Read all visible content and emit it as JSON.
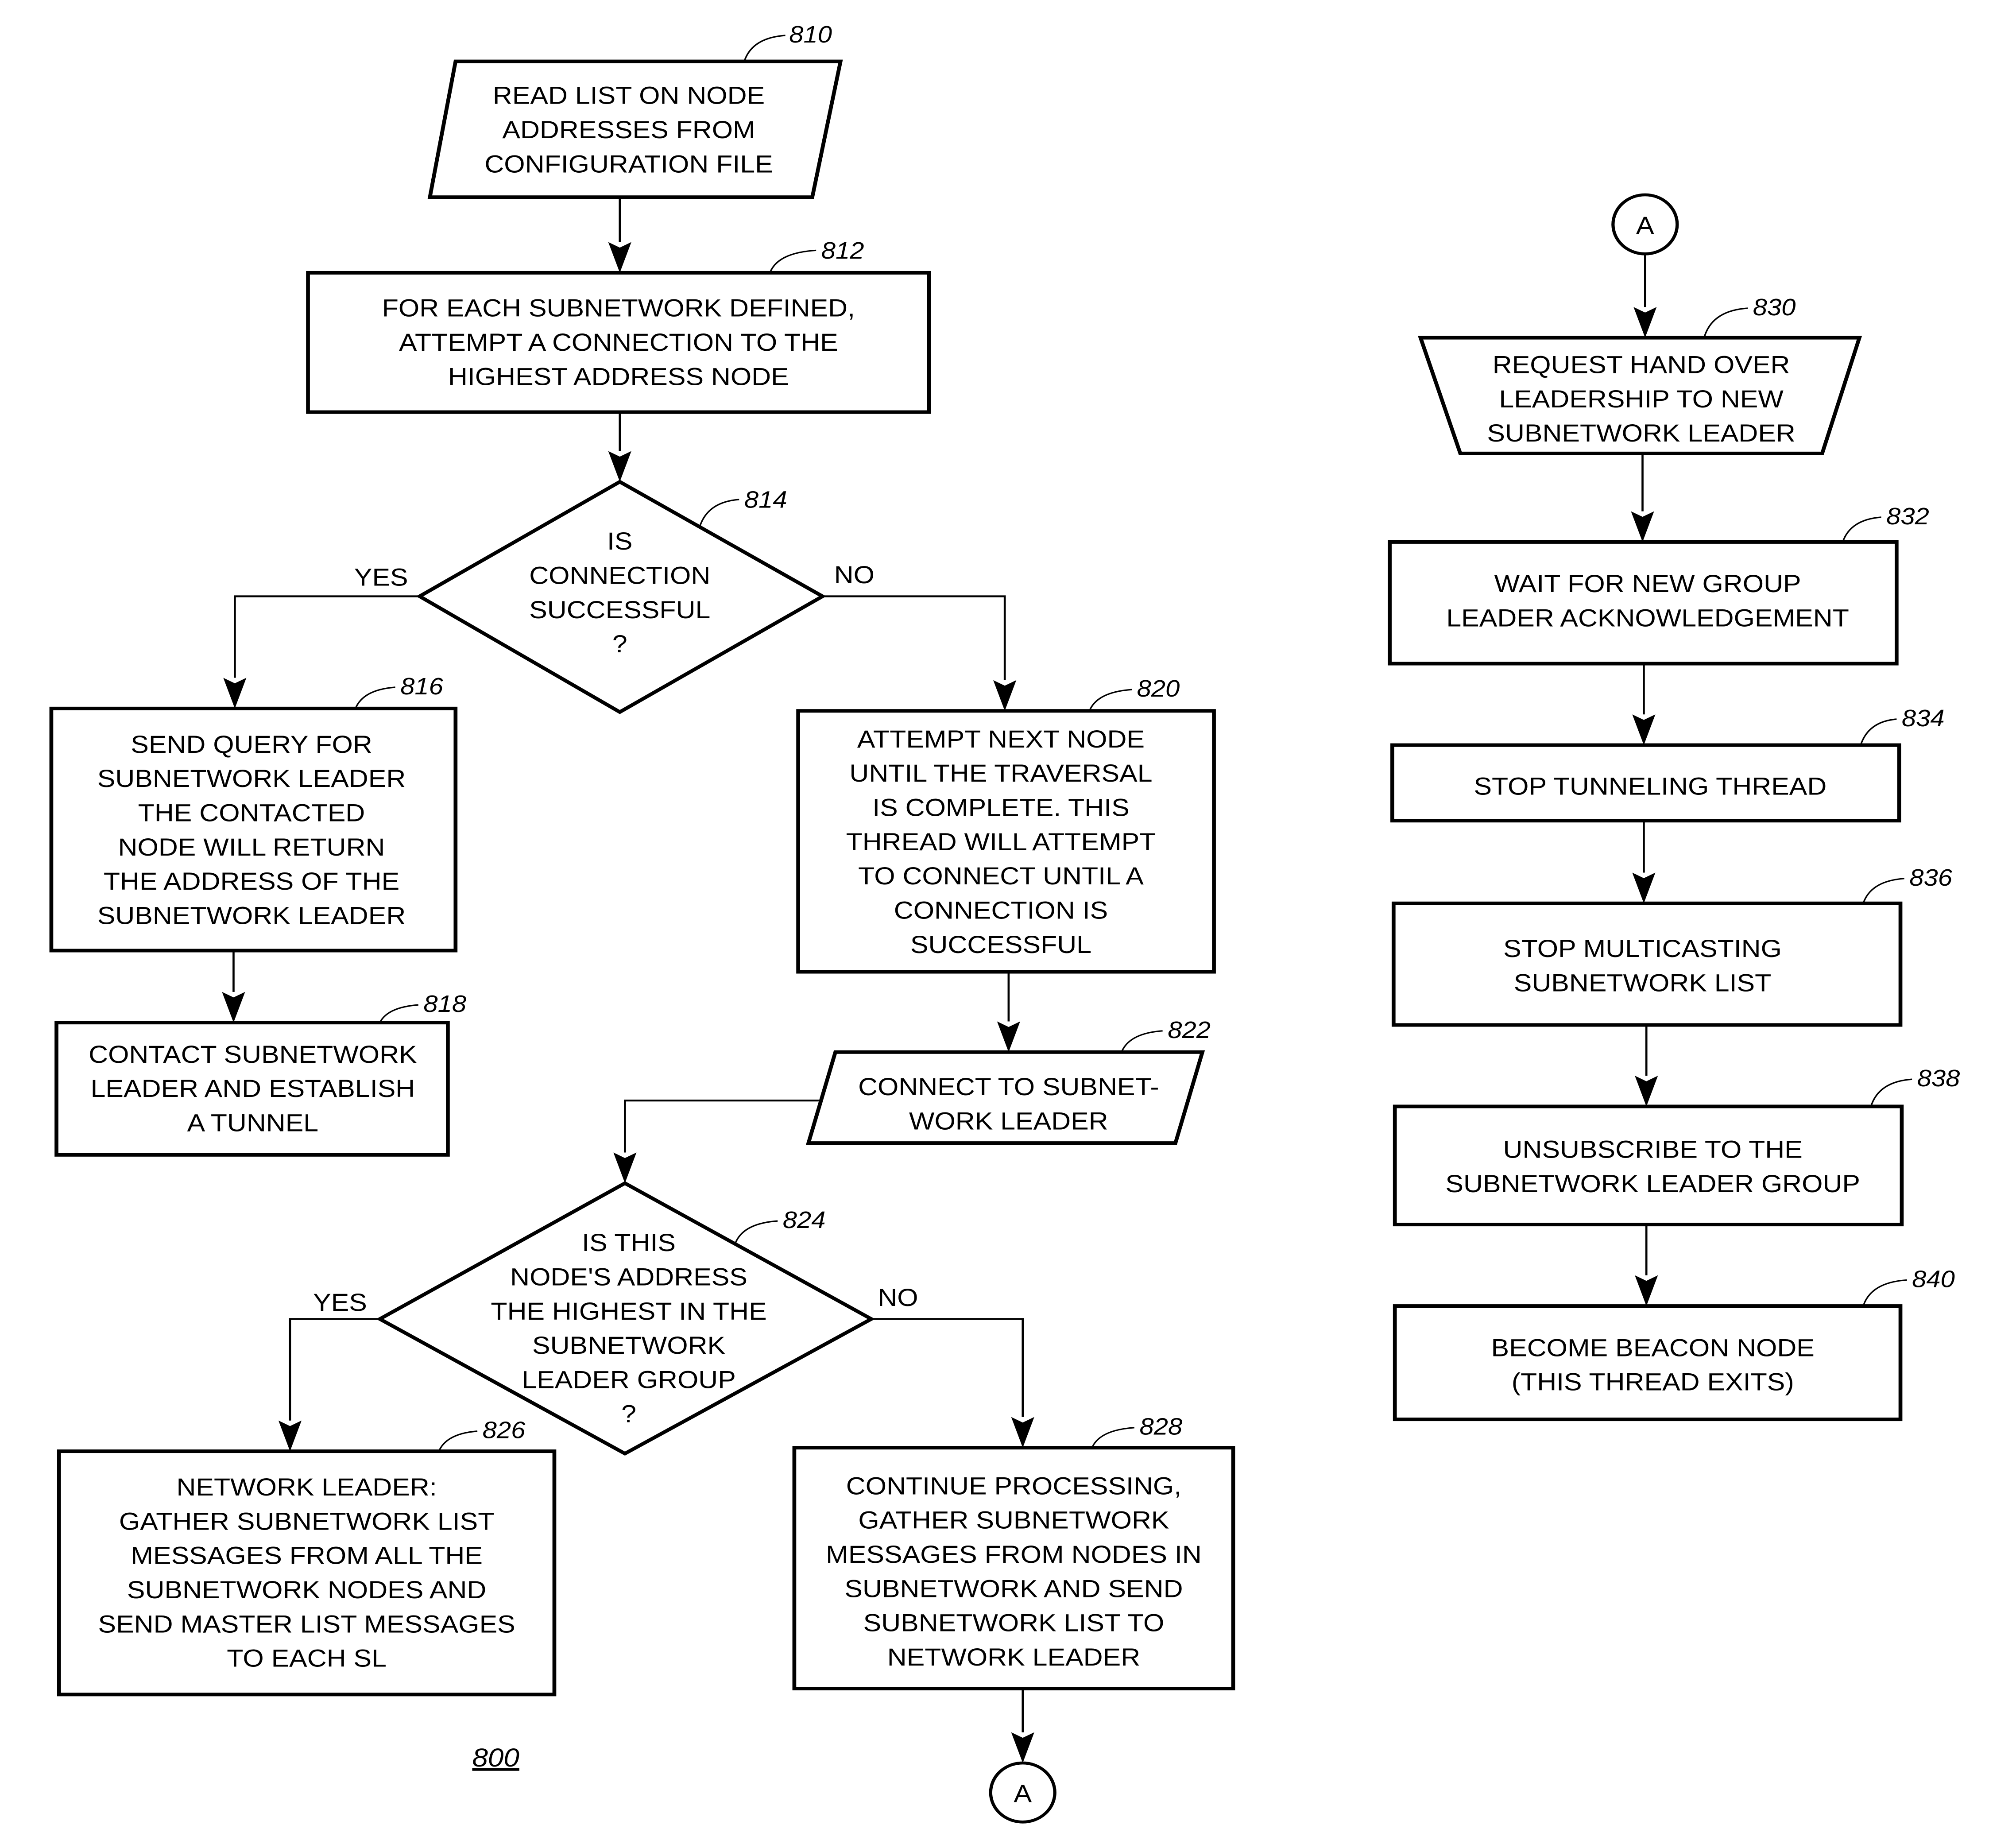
{
  "figure": {
    "number": "800",
    "nodes": [
      {
        "id": "810",
        "type": "io",
        "lines": [
          "READ LIST ON NODE",
          "ADDRESSES FROM",
          "CONFIGURATION FILE"
        ]
      },
      {
        "id": "812",
        "type": "process",
        "lines": [
          "FOR EACH SUBNETWORK DEFINED,",
          "ATTEMPT A CONNECTION TO THE",
          "HIGHEST ADDRESS NODE"
        ]
      },
      {
        "id": "814",
        "type": "decision",
        "lines": [
          "IS",
          "CONNECTION",
          "SUCCESSFUL",
          "?"
        ]
      },
      {
        "id": "816",
        "type": "process",
        "lines": [
          "SEND QUERY FOR",
          "SUBNETWORK LEADER",
          "THE CONTACTED",
          "NODE WILL RETURN",
          "THE ADDRESS OF THE",
          "SUBNETWORK LEADER"
        ]
      },
      {
        "id": "818",
        "type": "process",
        "lines": [
          "CONTACT SUBNETWORK",
          "LEADER AND ESTABLISH",
          "A TUNNEL"
        ]
      },
      {
        "id": "820",
        "type": "process",
        "lines": [
          "ATTEMPT NEXT NODE",
          "UNTIL THE TRAVERSAL",
          "IS COMPLETE. THIS",
          "THREAD WILL ATTEMPT",
          "TO CONNECT UNTIL A",
          "CONNECTION IS",
          "SUCCESSFUL"
        ]
      },
      {
        "id": "822",
        "type": "io",
        "lines": [
          "CONNECT TO SUBNET-",
          "WORK LEADER"
        ]
      },
      {
        "id": "824",
        "type": "decision",
        "lines": [
          "IS THIS",
          "NODE'S ADDRESS",
          "THE HIGHEST IN THE",
          "SUBNETWORK",
          "LEADER GROUP",
          "?"
        ]
      },
      {
        "id": "826",
        "type": "process",
        "lines": [
          "NETWORK LEADER:",
          "GATHER SUBNETWORK LIST",
          "MESSAGES FROM ALL THE",
          "SUBNETWORK NODES AND",
          "SEND MASTER LIST MESSAGES",
          "TO EACH SL"
        ]
      },
      {
        "id": "828",
        "type": "process",
        "lines": [
          "CONTINUE PROCESSING,",
          "GATHER SUBNETWORK",
          "MESSAGES FROM NODES IN",
          "SUBNETWORK AND SEND",
          "SUBNETWORK LIST TO",
          "NETWORK LEADER"
        ]
      },
      {
        "id": "830",
        "type": "manual-operation",
        "lines": [
          "REQUEST HAND OVER",
          "LEADERSHIP TO NEW",
          "SUBNETWORK LEADER"
        ]
      },
      {
        "id": "832",
        "type": "process",
        "lines": [
          "WAIT FOR NEW GROUP",
          "LEADER ACKNOWLEDGEMENT"
        ]
      },
      {
        "id": "834",
        "type": "process",
        "lines": [
          "STOP TUNNELING THREAD"
        ]
      },
      {
        "id": "836",
        "type": "process",
        "lines": [
          "STOP MULTICASTING",
          "SUBNETWORK LIST"
        ]
      },
      {
        "id": "838",
        "type": "process",
        "lines": [
          "UNSUBSCRIBE TO THE",
          "SUBNETWORK LEADER GROUP"
        ]
      },
      {
        "id": "840",
        "type": "process",
        "lines": [
          "BECOME BEACON NODE",
          "(THIS THREAD EXITS)"
        ]
      }
    ],
    "connectors": [
      {
        "id": "connector-a-out",
        "label": "A"
      },
      {
        "id": "connector-a-in",
        "label": "A"
      }
    ],
    "branch_labels": {
      "d814_yes": "YES",
      "d814_no": "NO",
      "d824_yes": "YES",
      "d824_no": "NO"
    },
    "edges": [
      {
        "from": "810",
        "to": "812"
      },
      {
        "from": "812",
        "to": "814"
      },
      {
        "from": "814",
        "to": "816",
        "label": "YES"
      },
      {
        "from": "814",
        "to": "820",
        "label": "NO"
      },
      {
        "from": "816",
        "to": "818"
      },
      {
        "from": "820",
        "to": "822"
      },
      {
        "from": "822",
        "to": "824"
      },
      {
        "from": "824",
        "to": "826",
        "label": "YES"
      },
      {
        "from": "824",
        "to": "828",
        "label": "NO"
      },
      {
        "from": "828",
        "to": "A"
      },
      {
        "from": "A",
        "to": "830"
      },
      {
        "from": "830",
        "to": "832"
      },
      {
        "from": "832",
        "to": "834"
      },
      {
        "from": "834",
        "to": "836"
      },
      {
        "from": "836",
        "to": "838"
      },
      {
        "from": "838",
        "to": "840"
      }
    ]
  }
}
